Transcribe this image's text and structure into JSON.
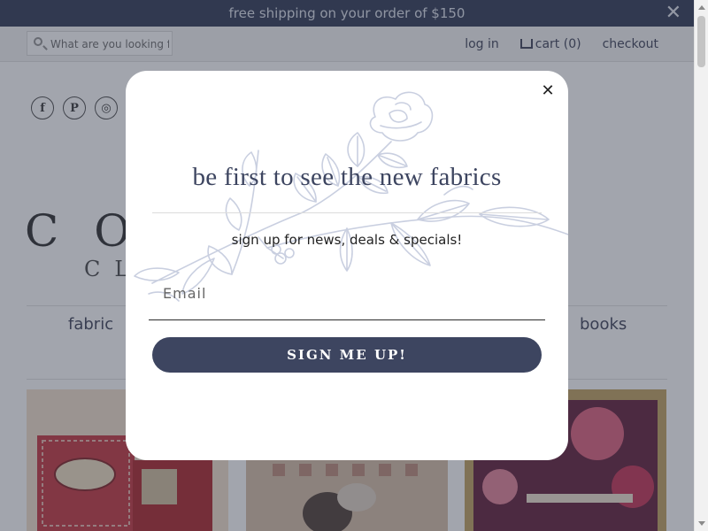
{
  "announcement": {
    "text": "free shipping on your order of $150",
    "close_glyph": "✕"
  },
  "header": {
    "search": {
      "placeholder": "What are you looking for?"
    },
    "nav": {
      "login": "log in",
      "cart": "cart (0)",
      "checkout": "checkout"
    }
  },
  "social": {
    "facebook": "f",
    "pinterest": "P",
    "instagram": "◎"
  },
  "logo": {
    "main": "CO",
    "sub": "CL"
  },
  "main_nav": {
    "fabric": "fabric",
    "books": "books"
  },
  "modal": {
    "close_glyph": "✕",
    "title": "be first to see the new fabrics",
    "subtitle": "sign up for news, deals & specials!",
    "email_placeholder": "Email",
    "submit_label": "SIGN ME UP!"
  },
  "colors": {
    "accent": "#3d4560",
    "overlay": "rgba(33,40,60,0.42)",
    "floral_line": "#c9cfe0"
  },
  "icons": [
    "search-icon",
    "cart-icon",
    "facebook-icon",
    "pinterest-icon",
    "instagram-icon",
    "close-icon",
    "floral-illustration"
  ]
}
